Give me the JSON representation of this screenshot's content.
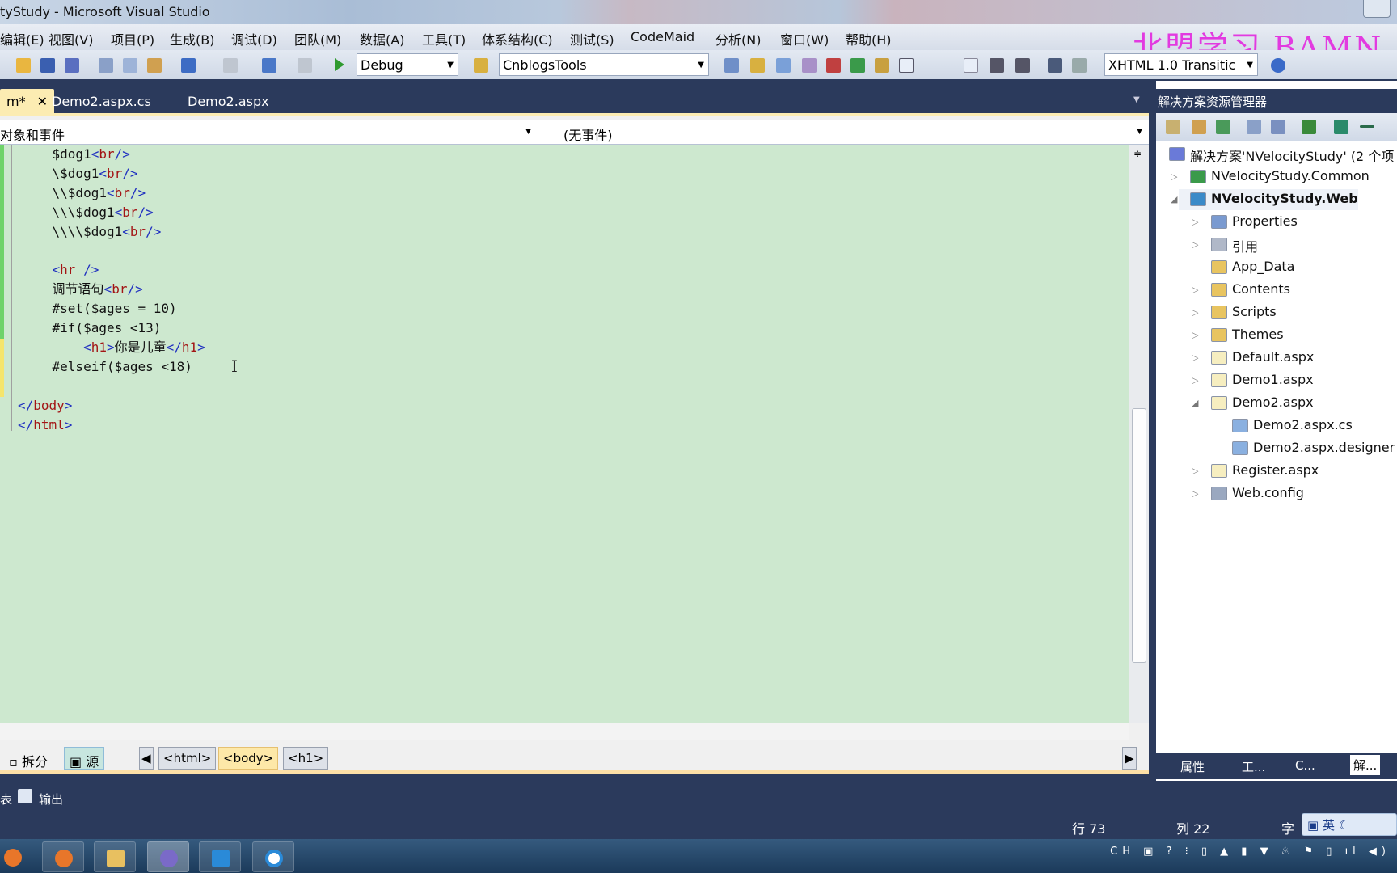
{
  "window": {
    "title": "tyStudy - Microsoft Visual Studio"
  },
  "menu": [
    "编辑(E)",
    "视图(V)",
    "项目(P)",
    "生成(B)",
    "调试(D)",
    "团队(M)",
    "数据(A)",
    "工具(T)",
    "体系结构(C)",
    "测试(S)",
    "CodeMaid",
    "分析(N)",
    "窗口(W)",
    "帮助(H)"
  ],
  "watermark": "北盟学习 BAMN.",
  "toolbar": {
    "config": "Debug",
    "project_combo": "CnblogsTools",
    "doctype": "XHTML 1.0 Transitic"
  },
  "tabs": [
    {
      "label": "m*",
      "active": true
    },
    {
      "label": "Demo2.aspx.cs"
    },
    {
      "label": "Demo2.aspx"
    }
  ],
  "tab_close": "✕",
  "navbar": {
    "objects": "对象和事件",
    "events": "(无事件)"
  },
  "code": [
    [
      [
        "txt",
        "    $dog1"
      ],
      [
        "br",
        "<"
      ],
      [
        "tag",
        "br"
      ],
      [
        "br",
        "/>"
      ]
    ],
    [
      [
        "txt",
        "    \\$dog1"
      ],
      [
        "br",
        "<"
      ],
      [
        "tag",
        "br"
      ],
      [
        "br",
        "/>"
      ]
    ],
    [
      [
        "txt",
        "    \\\\$dog1"
      ],
      [
        "br",
        "<"
      ],
      [
        "tag",
        "br"
      ],
      [
        "br",
        "/>"
      ]
    ],
    [
      [
        "txt",
        "    \\\\\\$dog1"
      ],
      [
        "br",
        "<"
      ],
      [
        "tag",
        "br"
      ],
      [
        "br",
        "/>"
      ]
    ],
    [
      [
        "txt",
        "    \\\\\\\\$dog1"
      ],
      [
        "br",
        "<"
      ],
      [
        "tag",
        "br"
      ],
      [
        "br",
        "/>"
      ]
    ],
    [],
    [
      [
        "txt",
        "    "
      ],
      [
        "br",
        "<"
      ],
      [
        "tag",
        "hr"
      ],
      [
        "br",
        " />"
      ]
    ],
    [
      [
        "txt",
        "    调节语句"
      ],
      [
        "br",
        "<"
      ],
      [
        "tag",
        "br"
      ],
      [
        "br",
        "/>"
      ]
    ],
    [
      [
        "txt",
        "    #set($ages = 10)"
      ]
    ],
    [
      [
        "txt",
        "    #if($ages <13)"
      ]
    ],
    [
      [
        "txt",
        "        "
      ],
      [
        "br",
        "<"
      ],
      [
        "tag",
        "h1"
      ],
      [
        "br",
        ">"
      ],
      [
        "txt",
        "你是儿童"
      ],
      [
        "br",
        "</"
      ],
      [
        "tag",
        "h1"
      ],
      [
        "br",
        ">"
      ]
    ],
    [
      [
        "txt",
        "    #elseif($ages <18)"
      ]
    ],
    [],
    [
      [
        "br",
        "</"
      ],
      [
        "tag",
        "body"
      ],
      [
        "br",
        ">"
      ]
    ],
    [
      [
        "br",
        "</"
      ],
      [
        "tag",
        "html"
      ],
      [
        "br",
        ">"
      ]
    ]
  ],
  "view_buttons": {
    "split": "拆分",
    "source": "源"
  },
  "breadcrumbs": [
    "<html>",
    "<body>",
    "<h1>"
  ],
  "solution_explorer": {
    "title": "解决方案资源管理器",
    "items": [
      {
        "label": "解决方案'NVelocityStudy' (2 个项",
        "level": 0,
        "icon": "solution-icon",
        "exp": ""
      },
      {
        "label": "NVelocityStudy.Common",
        "level": 1,
        "icon": "csharp-project-icon",
        "exp": "▷"
      },
      {
        "label": "NVelocityStudy.Web",
        "level": 1,
        "icon": "web-project-icon",
        "exp": "◢",
        "bold": true
      },
      {
        "label": "Properties",
        "level": 2,
        "icon": "properties-icon",
        "exp": "▷"
      },
      {
        "label": "引用",
        "level": 2,
        "icon": "references-icon",
        "exp": "▷"
      },
      {
        "label": "App_Data",
        "level": 2,
        "icon": "folder-icon",
        "exp": ""
      },
      {
        "label": "Contents",
        "level": 2,
        "icon": "folder-icon",
        "exp": "▷"
      },
      {
        "label": "Scripts",
        "level": 2,
        "icon": "folder-icon",
        "exp": "▷"
      },
      {
        "label": "Themes",
        "level": 2,
        "icon": "folder-icon",
        "exp": "▷"
      },
      {
        "label": "Default.aspx",
        "level": 2,
        "icon": "aspx-file-icon",
        "exp": "▷"
      },
      {
        "label": "Demo1.aspx",
        "level": 2,
        "icon": "aspx-file-icon",
        "exp": "▷"
      },
      {
        "label": "Demo2.aspx",
        "level": 2,
        "icon": "aspx-file-icon",
        "exp": "◢"
      },
      {
        "label": "Demo2.aspx.cs",
        "level": 3,
        "icon": "cs-file-icon",
        "exp": ""
      },
      {
        "label": "Demo2.aspx.designer",
        "level": 3,
        "icon": "cs-file-icon",
        "exp": ""
      },
      {
        "label": "Register.aspx",
        "level": 2,
        "icon": "aspx-file-icon",
        "exp": "▷"
      },
      {
        "label": "Web.config",
        "level": 2,
        "icon": "config-file-icon",
        "exp": "▷"
      }
    ],
    "bottom_tabs": [
      "属性",
      "工...",
      "C...",
      "解..."
    ]
  },
  "output_tabs": [
    "表",
    "输出"
  ],
  "status": {
    "line": "行 73",
    "col": "列 22",
    "char": "字"
  },
  "ime": "英",
  "tray": {
    "lang": "CH"
  }
}
